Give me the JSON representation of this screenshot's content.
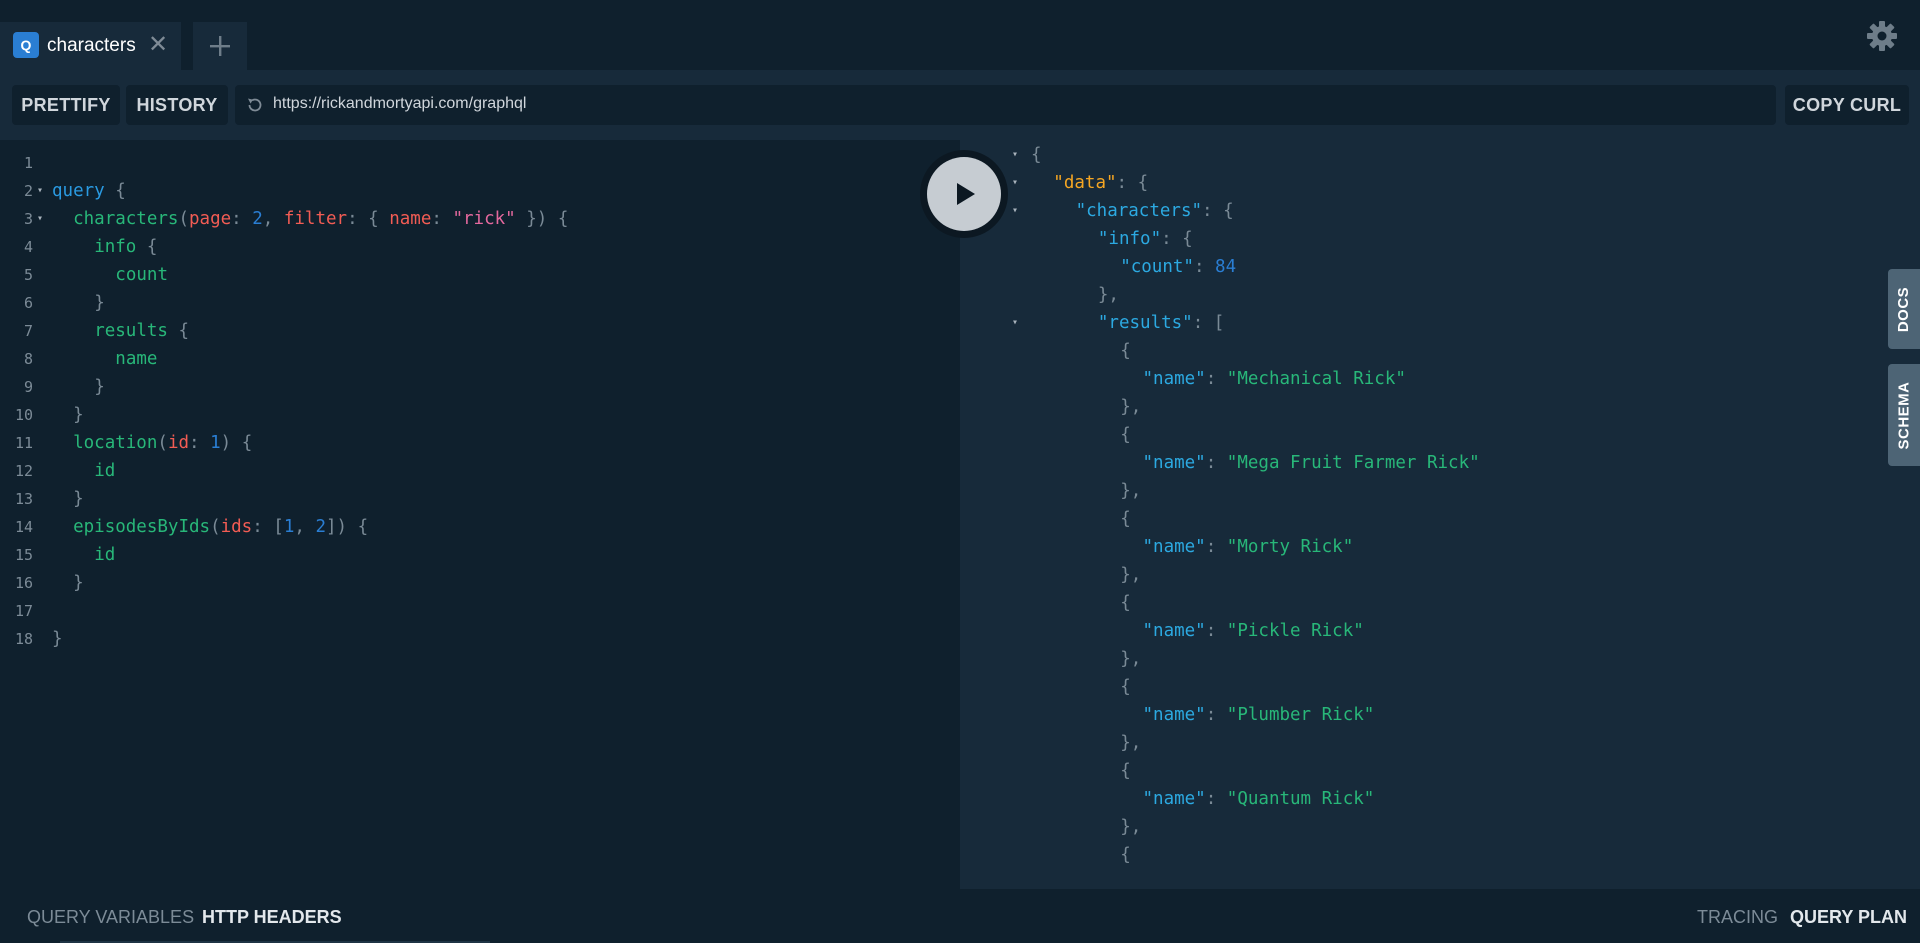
{
  "tabs": [
    {
      "badge": "Q",
      "title": "characters",
      "close": "✕"
    }
  ],
  "toolbar": {
    "prettify_label": "PRETTIFY",
    "history_label": "HISTORY",
    "url": "https://rickandmortyapi.com/graphql",
    "copy_curl_label": "COPY CURL"
  },
  "icons": {
    "add_tab": "plus-icon",
    "settings": "gear-icon",
    "refresh": "refresh-icon",
    "run": "play-icon"
  },
  "editor": {
    "lines": [
      {
        "n": "1",
        "fold": false,
        "indent": 0,
        "tokens": []
      },
      {
        "n": "2",
        "fold": true,
        "indent": 0,
        "tokens": [
          [
            "kw",
            "query"
          ],
          [
            "punc",
            " {"
          ]
        ]
      },
      {
        "n": "3",
        "fold": true,
        "indent": 1,
        "tokens": [
          [
            "field",
            "characters"
          ],
          [
            "punc",
            "("
          ],
          [
            "arg",
            "page"
          ],
          [
            "punc",
            ": "
          ],
          [
            "num",
            "2"
          ],
          [
            "punc",
            ", "
          ],
          [
            "arg",
            "filter"
          ],
          [
            "punc",
            ": { "
          ],
          [
            "arg",
            "name"
          ],
          [
            "punc",
            ": "
          ],
          [
            "str",
            "\"rick\""
          ],
          [
            "punc",
            " }) {"
          ]
        ]
      },
      {
        "n": "4",
        "fold": false,
        "indent": 2,
        "tokens": [
          [
            "field",
            "info"
          ],
          [
            "punc",
            " {"
          ]
        ]
      },
      {
        "n": "5",
        "fold": false,
        "indent": 3,
        "tokens": [
          [
            "field",
            "count"
          ]
        ]
      },
      {
        "n": "6",
        "fold": false,
        "indent": 2,
        "tokens": [
          [
            "punc",
            "}"
          ]
        ]
      },
      {
        "n": "7",
        "fold": false,
        "indent": 2,
        "tokens": [
          [
            "field",
            "results"
          ],
          [
            "punc",
            " {"
          ]
        ]
      },
      {
        "n": "8",
        "fold": false,
        "indent": 3,
        "tokens": [
          [
            "field",
            "name"
          ]
        ]
      },
      {
        "n": "9",
        "fold": false,
        "indent": 2,
        "tokens": [
          [
            "punc",
            "}"
          ]
        ]
      },
      {
        "n": "10",
        "fold": false,
        "indent": 1,
        "tokens": [
          [
            "punc",
            "}"
          ]
        ]
      },
      {
        "n": "11",
        "fold": false,
        "indent": 1,
        "tokens": [
          [
            "field",
            "location"
          ],
          [
            "punc",
            "("
          ],
          [
            "arg",
            "id"
          ],
          [
            "punc",
            ": "
          ],
          [
            "num",
            "1"
          ],
          [
            "punc",
            ") {"
          ]
        ]
      },
      {
        "n": "12",
        "fold": false,
        "indent": 2,
        "tokens": [
          [
            "field",
            "id"
          ]
        ]
      },
      {
        "n": "13",
        "fold": false,
        "indent": 1,
        "tokens": [
          [
            "punc",
            "}"
          ]
        ]
      },
      {
        "n": "14",
        "fold": false,
        "indent": 1,
        "tokens": [
          [
            "field",
            "episodesByIds"
          ],
          [
            "punc",
            "("
          ],
          [
            "arg",
            "ids"
          ],
          [
            "punc",
            ": ["
          ],
          [
            "num",
            "1"
          ],
          [
            "punc",
            ", "
          ],
          [
            "num",
            "2"
          ],
          [
            "punc",
            "]) {"
          ]
        ]
      },
      {
        "n": "15",
        "fold": false,
        "indent": 2,
        "tokens": [
          [
            "field",
            "id"
          ]
        ]
      },
      {
        "n": "16",
        "fold": false,
        "indent": 1,
        "tokens": [
          [
            "punc",
            "}"
          ]
        ]
      },
      {
        "n": "17",
        "fold": false,
        "indent": 0,
        "tokens": []
      },
      {
        "n": "18",
        "fold": false,
        "indent": 0,
        "tokens": [
          [
            "punc",
            "}"
          ]
        ]
      }
    ]
  },
  "result": {
    "lines": [
      {
        "fold": true,
        "indent": 0,
        "tokens": [
          [
            "punc",
            "{"
          ]
        ]
      },
      {
        "fold": true,
        "indent": 1,
        "tokens": [
          [
            "data",
            "\"data\""
          ],
          [
            "punc",
            ": {"
          ]
        ]
      },
      {
        "fold": true,
        "indent": 2,
        "tokens": [
          [
            "key",
            "\"characters\""
          ],
          [
            "punc",
            ": {"
          ]
        ]
      },
      {
        "fold": false,
        "indent": 3,
        "tokens": [
          [
            "key",
            "\"info\""
          ],
          [
            "punc",
            ": {"
          ]
        ]
      },
      {
        "fold": false,
        "indent": 4,
        "tokens": [
          [
            "key",
            "\"count\""
          ],
          [
            "punc",
            ": "
          ],
          [
            "num",
            "84"
          ]
        ]
      },
      {
        "fold": false,
        "indent": 3,
        "tokens": [
          [
            "punc",
            "},"
          ]
        ]
      },
      {
        "fold": true,
        "indent": 3,
        "tokens": [
          [
            "key",
            "\"results\""
          ],
          [
            "punc",
            ": ["
          ]
        ]
      },
      {
        "fold": false,
        "indent": 4,
        "tokens": [
          [
            "punc",
            "{"
          ]
        ]
      },
      {
        "fold": false,
        "indent": 5,
        "tokens": [
          [
            "key",
            "\"name\""
          ],
          [
            "punc",
            ": "
          ],
          [
            "sval",
            "\"Mechanical Rick\""
          ]
        ]
      },
      {
        "fold": false,
        "indent": 4,
        "tokens": [
          [
            "punc",
            "},"
          ]
        ]
      },
      {
        "fold": false,
        "indent": 4,
        "tokens": [
          [
            "punc",
            "{"
          ]
        ]
      },
      {
        "fold": false,
        "indent": 5,
        "tokens": [
          [
            "key",
            "\"name\""
          ],
          [
            "punc",
            ": "
          ],
          [
            "sval",
            "\"Mega Fruit Farmer Rick\""
          ]
        ]
      },
      {
        "fold": false,
        "indent": 4,
        "tokens": [
          [
            "punc",
            "},"
          ]
        ]
      },
      {
        "fold": false,
        "indent": 4,
        "tokens": [
          [
            "punc",
            "{"
          ]
        ]
      },
      {
        "fold": false,
        "indent": 5,
        "tokens": [
          [
            "key",
            "\"name\""
          ],
          [
            "punc",
            ": "
          ],
          [
            "sval",
            "\"Morty Rick\""
          ]
        ]
      },
      {
        "fold": false,
        "indent": 4,
        "tokens": [
          [
            "punc",
            "},"
          ]
        ]
      },
      {
        "fold": false,
        "indent": 4,
        "tokens": [
          [
            "punc",
            "{"
          ]
        ]
      },
      {
        "fold": false,
        "indent": 5,
        "tokens": [
          [
            "key",
            "\"name\""
          ],
          [
            "punc",
            ": "
          ],
          [
            "sval",
            "\"Pickle Rick\""
          ]
        ]
      },
      {
        "fold": false,
        "indent": 4,
        "tokens": [
          [
            "punc",
            "},"
          ]
        ]
      },
      {
        "fold": false,
        "indent": 4,
        "tokens": [
          [
            "punc",
            "{"
          ]
        ]
      },
      {
        "fold": false,
        "indent": 5,
        "tokens": [
          [
            "key",
            "\"name\""
          ],
          [
            "punc",
            ": "
          ],
          [
            "sval",
            "\"Plumber Rick\""
          ]
        ]
      },
      {
        "fold": false,
        "indent": 4,
        "tokens": [
          [
            "punc",
            "},"
          ]
        ]
      },
      {
        "fold": false,
        "indent": 4,
        "tokens": [
          [
            "punc",
            "{"
          ]
        ]
      },
      {
        "fold": false,
        "indent": 5,
        "tokens": [
          [
            "key",
            "\"name\""
          ],
          [
            "punc",
            ": "
          ],
          [
            "sval",
            "\"Quantum Rick\""
          ]
        ]
      },
      {
        "fold": false,
        "indent": 4,
        "tokens": [
          [
            "punc",
            "},"
          ]
        ]
      },
      {
        "fold": false,
        "indent": 4,
        "tokens": [
          [
            "punc",
            "{"
          ]
        ]
      }
    ]
  },
  "side_tabs": {
    "docs": "DOCS",
    "schema": "SCHEMA"
  },
  "bottom": {
    "query_variables": "QUERY VARIABLES",
    "http_headers": "HTTP HEADERS",
    "tracing": "TRACING",
    "query_plan": "QUERY PLAN"
  },
  "colors": {
    "background": "#172a3a",
    "editor_bg": "#0f202d",
    "keyword": "#2a9ae1",
    "field": "#28b779",
    "argument": "#f25c54",
    "string": "#e3689d",
    "number": "#2a7ed3",
    "data_key": "#f5a623"
  }
}
